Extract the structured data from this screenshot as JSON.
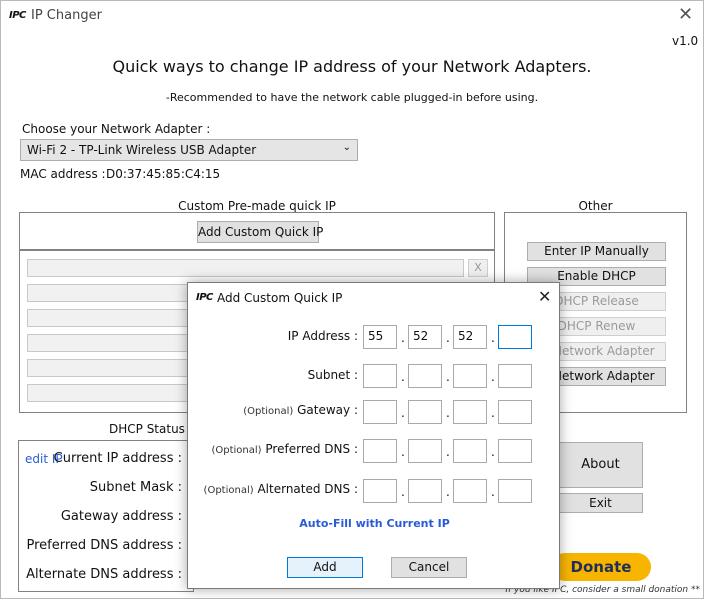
{
  "window": {
    "logo": "IPC",
    "title": "IP Changer",
    "version": "v1.0"
  },
  "header": {
    "headline": "Quick ways to change IP address of your Network Adapters.",
    "subline": "-Recommended to have the network cable plugged-in before using."
  },
  "adapter": {
    "label": "Choose your Network Adapter :",
    "selected": "Wi-Fi 2 - TP-Link Wireless USB Adapter",
    "mac_label": "MAC address :",
    "mac_value": "D0:37:45:85:C4:15"
  },
  "quick_ip": {
    "title": "Custom Pre-made quick IP",
    "add_button": "Add Custom Quick IP",
    "remove_button": "X"
  },
  "other": {
    "title": "Other",
    "buttons": [
      "Enter IP Manually",
      "Enable DHCP",
      "DHCP Release",
      "DHCP Renew",
      "le Network Adapter",
      "le Network Adapter"
    ]
  },
  "status": {
    "dhcp_label": "DHCP Status :",
    "edit_ip": "edit IP",
    "current_ip_label": "Current IP address :",
    "subnet_label": "Subnet Mask :",
    "gateway_label": "Gateway address :",
    "preferred_dns_label": "Preferred DNS address :",
    "alternate_dns_label": "Alternate DNS address :"
  },
  "side": {
    "about": "About",
    "exit": "Exit",
    "donate": "Donate",
    "donate_note": "If you like IPC, consider a small donation **"
  },
  "dialog": {
    "logo": "IPC",
    "title": "Add Custom Quick IP",
    "ip_label": "IP Address :",
    "ip_values": [
      "55",
      "52",
      "52",
      ""
    ],
    "subnet_label": "Subnet :",
    "gateway_optional": "(Optional)",
    "gateway_label": "Gateway :",
    "pref_optional": "(Optional)",
    "pref_label": "Preferred DNS :",
    "alt_optional": "(Optional)",
    "alt_label": "Alternated DNS :",
    "autofill": "Auto-Fill with Current IP",
    "add_button": "Add",
    "cancel_button": "Cancel",
    "dot": ".",
    "close": "✕"
  },
  "colors": {
    "link_blue": "#2a5bd7",
    "donate_yellow": "#f7b500",
    "dialog_border": "#7a7a7a"
  }
}
